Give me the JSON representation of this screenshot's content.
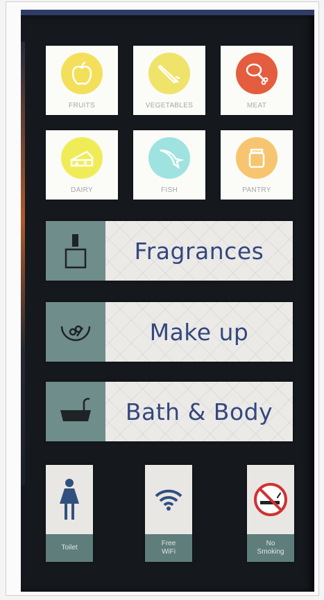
{
  "categories": [
    {
      "label": "FRUITS",
      "icon": "apple-icon",
      "color": "#f3df5a"
    },
    {
      "label": "VEGETABLES",
      "icon": "carrot-icon",
      "color": "#efe36a"
    },
    {
      "label": "MEAT",
      "icon": "drumstick-icon",
      "color": "#e45d3e"
    },
    {
      "label": "DAIRY",
      "icon": "cheese-icon",
      "color": "#f0ec58"
    },
    {
      "label": "FISH",
      "icon": "fish-icon",
      "color": "#9fe3e0"
    },
    {
      "label": "PANTRY",
      "icon": "jar-icon",
      "color": "#f7c56f"
    }
  ],
  "sections": [
    {
      "label": "Fragrances",
      "icon": "perfume-bottle-icon"
    },
    {
      "label": "Make up",
      "icon": "makeup-icon"
    },
    {
      "label": "Bath & Body",
      "icon": "bathtub-icon"
    }
  ],
  "facilities": [
    {
      "label": "Toilet",
      "icon": "woman-icon"
    },
    {
      "label": "Free\nWiFi",
      "icon": "wifi-icon"
    },
    {
      "label": "No\nSmoking",
      "icon": "no-smoking-icon"
    }
  ],
  "colors": {
    "board": "#15181d",
    "teal": "#6f8d8b",
    "text_navy": "#34477f"
  }
}
